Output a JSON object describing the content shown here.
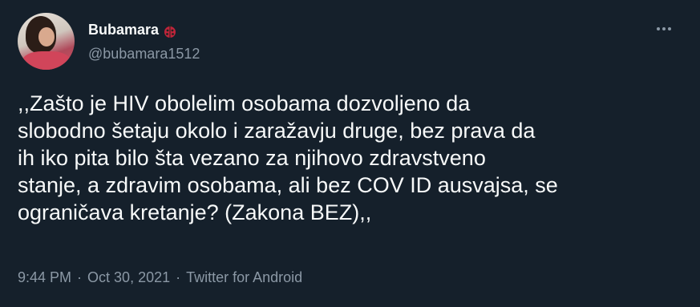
{
  "tweet": {
    "author": {
      "display_name": "Bubamara",
      "badge_icon": "ladybug-icon",
      "handle": "@bubamara1512"
    },
    "menu_icon": "more-options-icon",
    "text": ",,Zašto je HIV obolelim osobama dozvoljeno da\nslobodno šetaju okolo i zaražavju druge, bez prava da\nih iko pita bilo šta vezano za njihovo zdravstveno\nstanje, a zdravim osobama, ali bez COV ID ausvajsa, se\nograničava kretanje? (Zakona BEZ),,",
    "meta": {
      "time": "9:44 PM",
      "separator": "·",
      "date": "Oct 30, 2021",
      "source": "Twitter for Android"
    }
  },
  "colors": {
    "background": "#15202b",
    "primary_text": "#f7f9f9",
    "secondary_text": "#8b98a5",
    "badge": "#c0243b"
  }
}
